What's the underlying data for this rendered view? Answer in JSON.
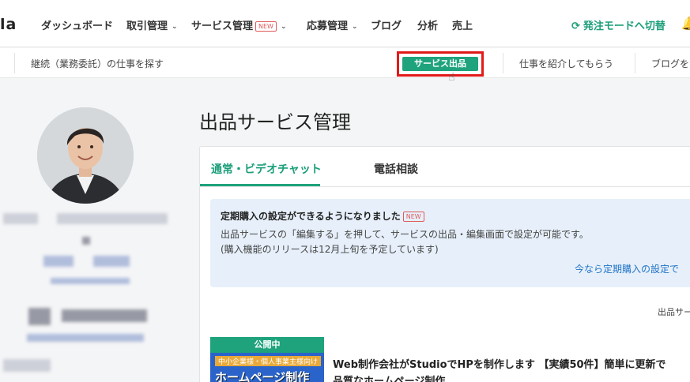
{
  "nav": {
    "logo": "la",
    "items": [
      {
        "label": "ダッシュボード"
      },
      {
        "label": "取引管理"
      },
      {
        "label": "サービス管理"
      },
      {
        "label": "応募管理"
      },
      {
        "label": "ブログ"
      },
      {
        "label": "分析"
      },
      {
        "label": "売上"
      }
    ],
    "new_badge": "NEW",
    "switch_label": "発注モードへ切替",
    "switch_icon": "refresh-icon",
    "bell_icon": "bell-icon"
  },
  "subnav": {
    "find_work": "継続（業務委託）の仕事を探す",
    "cta": "サービス出品",
    "introduce": "仕事を紹介してもらう",
    "blog": "ブログを"
  },
  "colors": {
    "accent": "#1fa37d",
    "highlight_box": "#e21a1a",
    "link": "#1e72c8",
    "notice_bg": "#e7f0fa"
  },
  "main": {
    "title": "出品サービス管理",
    "tabs": [
      {
        "label": "通常・ビデオチャット",
        "active": true
      },
      {
        "label": "電話相談",
        "active": false
      }
    ],
    "notice": {
      "title": "定期購入の設定ができるようになりました",
      "badge": "NEW",
      "line1": "出品サービスの「編集する」を押して、サービスの出品・編集画面で設定が可能です。",
      "line2": "(購入機能のリリースは12月上旬を予定しています)",
      "link": "今なら定期購入の設定で"
    },
    "sort_label": "出品サー",
    "service": {
      "status": "公開中",
      "thumb_sub": "中小企業様・個人事業主様向け",
      "thumb_main": "ホームページ制作",
      "title_line1": "Web制作会社がStudioでHPを制作します 【実績50件】簡単に更新で",
      "title_line2": "品質なホームページ制作"
    }
  }
}
